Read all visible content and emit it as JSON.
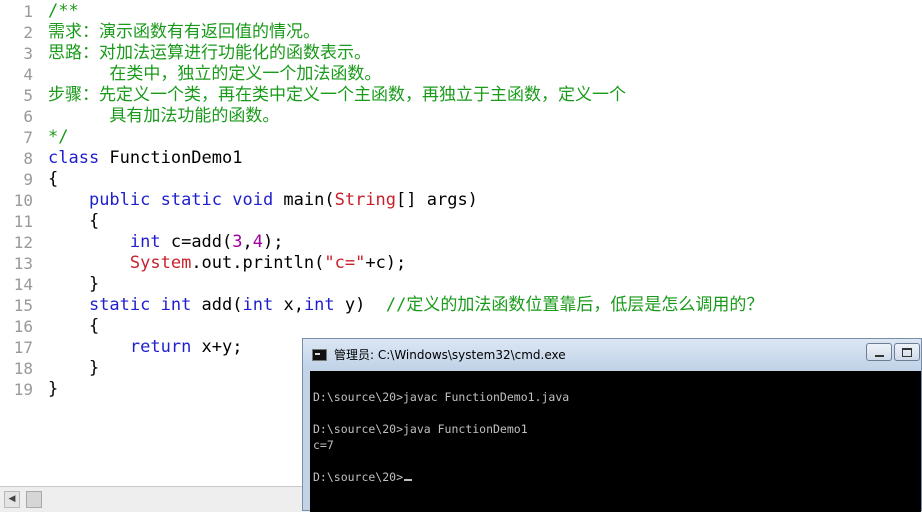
{
  "editor": {
    "lines": [
      {
        "n": "1",
        "segs": [
          {
            "c": "cm",
            "t": "/**"
          }
        ]
      },
      {
        "n": "2",
        "segs": [
          {
            "c": "cm",
            "t": "需求：演示函数有有返回值的情况。"
          }
        ]
      },
      {
        "n": "3",
        "segs": [
          {
            "c": "cm",
            "t": "思路：对加法运算进行功能化的函数表示。"
          }
        ]
      },
      {
        "n": "4",
        "segs": [
          {
            "c": "cm",
            "t": "      在类中，独立的定义一个加法函数。"
          }
        ]
      },
      {
        "n": "5",
        "segs": [
          {
            "c": "cm",
            "t": "步骤：先定义一个类，再在类中定义一个主函数，再独立于主函数，定义一个"
          }
        ]
      },
      {
        "n": "6",
        "segs": [
          {
            "c": "cm",
            "t": "      具有加法功能的函数。"
          }
        ]
      },
      {
        "n": "7",
        "segs": [
          {
            "c": "cm",
            "t": "*/"
          }
        ]
      },
      {
        "n": "8",
        "segs": [
          {
            "c": "kw",
            "t": "class"
          },
          {
            "c": "",
            "t": " FunctionDemo1"
          }
        ]
      },
      {
        "n": "9",
        "segs": [
          {
            "c": "",
            "t": "{"
          }
        ]
      },
      {
        "n": "10",
        "segs": [
          {
            "c": "",
            "t": "    "
          },
          {
            "c": "kw",
            "t": "public static void"
          },
          {
            "c": "",
            "t": " main("
          },
          {
            "c": "st",
            "t": "String"
          },
          {
            "c": "",
            "t": "[] args)"
          }
        ]
      },
      {
        "n": "11",
        "segs": [
          {
            "c": "",
            "t": "    {"
          }
        ]
      },
      {
        "n": "12",
        "segs": [
          {
            "c": "",
            "t": "        "
          },
          {
            "c": "kw",
            "t": "int"
          },
          {
            "c": "",
            "t": " c=add("
          },
          {
            "c": "num",
            "t": "3"
          },
          {
            "c": "",
            "t": ","
          },
          {
            "c": "num",
            "t": "4"
          },
          {
            "c": "",
            "t": ");"
          }
        ]
      },
      {
        "n": "13",
        "segs": [
          {
            "c": "",
            "t": "        "
          },
          {
            "c": "st",
            "t": "System"
          },
          {
            "c": "",
            "t": ".out.println("
          },
          {
            "c": "st",
            "t": "\"c=\""
          },
          {
            "c": "",
            "t": "+c);"
          }
        ]
      },
      {
        "n": "14",
        "segs": [
          {
            "c": "",
            "t": "    }"
          }
        ]
      },
      {
        "n": "15",
        "segs": [
          {
            "c": "",
            "t": "    "
          },
          {
            "c": "kw",
            "t": "static int"
          },
          {
            "c": "",
            "t": " add("
          },
          {
            "c": "kw",
            "t": "int"
          },
          {
            "c": "",
            "t": " x,"
          },
          {
            "c": "kw",
            "t": "int"
          },
          {
            "c": "",
            "t": " y)  "
          },
          {
            "c": "cm",
            "t": "//定义的加法函数位置靠后，低层是怎么调用的？"
          }
        ]
      },
      {
        "n": "16",
        "segs": [
          {
            "c": "",
            "t": "    {"
          }
        ]
      },
      {
        "n": "17",
        "segs": [
          {
            "c": "",
            "t": "        "
          },
          {
            "c": "kw",
            "t": "return"
          },
          {
            "c": "",
            "t": " x+y;"
          }
        ]
      },
      {
        "n": "18",
        "segs": [
          {
            "c": "",
            "t": "    }"
          }
        ]
      },
      {
        "n": "19",
        "segs": [
          {
            "c": "",
            "t": "}"
          }
        ]
      }
    ]
  },
  "cmd": {
    "title": "管理员: C:\\Windows\\system32\\cmd.exe",
    "lines": [
      "",
      "D:\\source\\20>javac FunctionDemo1.java",
      "",
      "D:\\source\\20>java FunctionDemo1",
      "c=7",
      "",
      "D:\\source\\20>"
    ]
  },
  "colors": {
    "comment": "#1a9a1a",
    "keyword": "#1f1fcf",
    "string_type": "#c8202a",
    "number": "#a000a0",
    "console_bg": "#000000",
    "console_text": "#c0c0c0"
  },
  "icons": {
    "cmd_icon": "console-icon",
    "minimize": "minimize-icon",
    "maximize": "maximize-icon",
    "scroll_left": "arrow-left-icon"
  }
}
